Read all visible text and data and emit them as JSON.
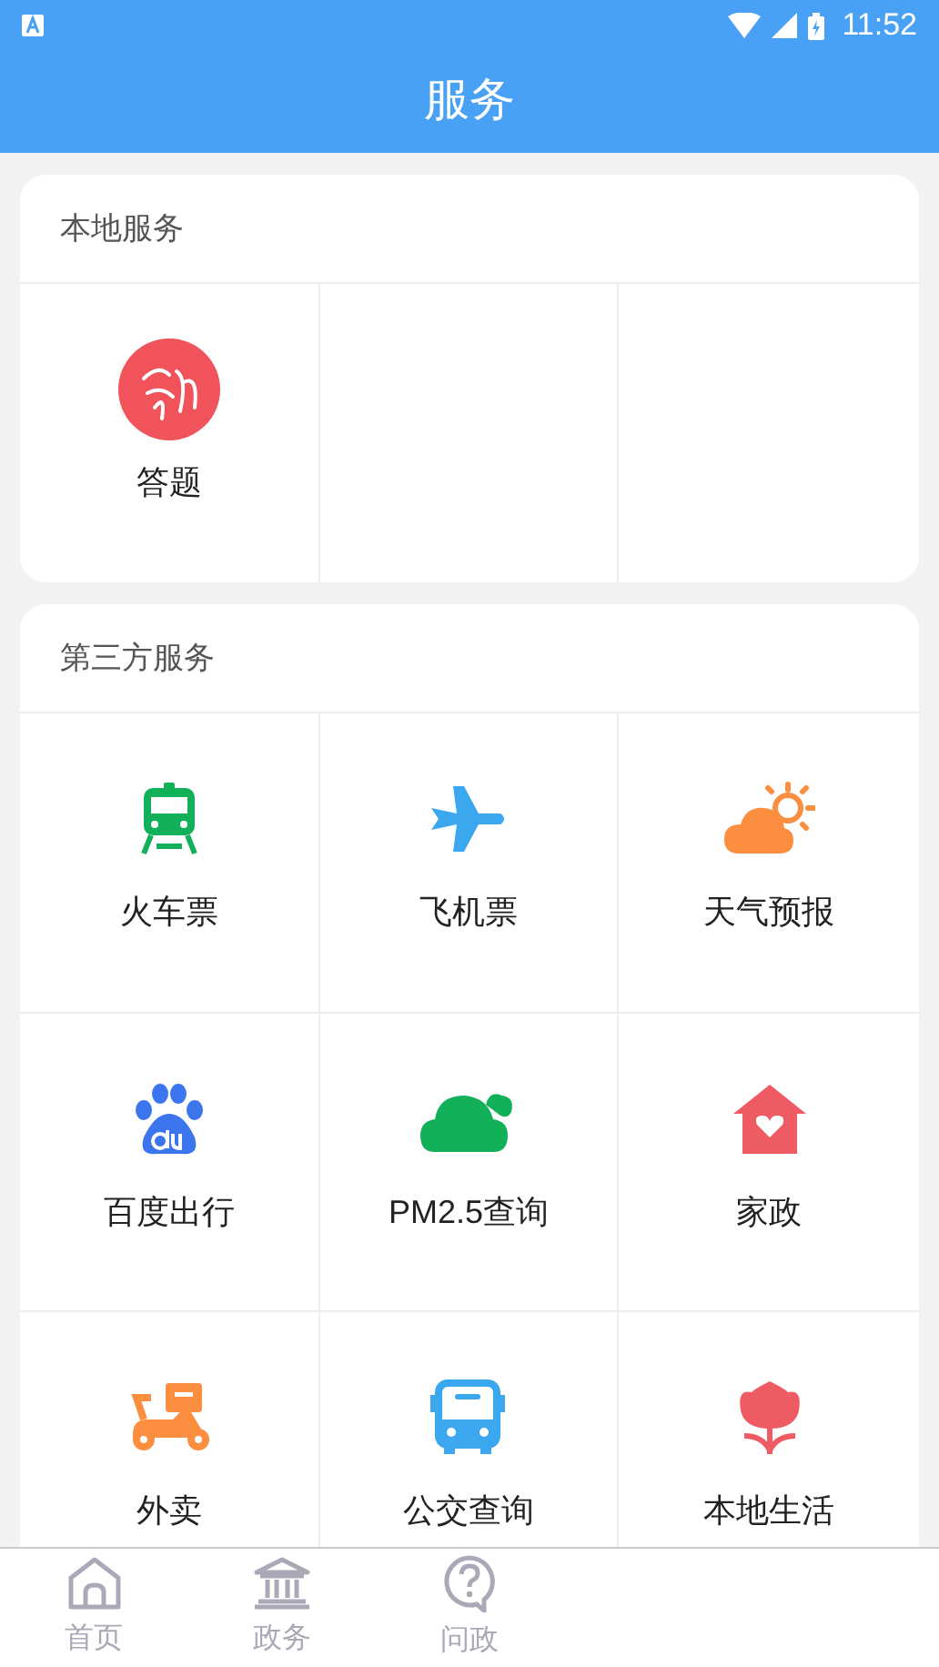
{
  "status_bar": {
    "time": "11:52"
  },
  "header": {
    "title": "服务"
  },
  "sections": [
    {
      "title": "本地服务",
      "items": [
        {
          "label": "答题",
          "kind": "study"
        }
      ]
    },
    {
      "title": "第三方服务",
      "items": [
        {
          "label": "火车票",
          "kind": "train"
        },
        {
          "label": "飞机票",
          "kind": "plane"
        },
        {
          "label": "天气预报",
          "kind": "weather"
        },
        {
          "label": "百度出行",
          "kind": "paw"
        },
        {
          "label": "PM2.5查询",
          "kind": "pm"
        },
        {
          "label": "家政",
          "kind": "house"
        },
        {
          "label": "外卖",
          "kind": "scooter"
        },
        {
          "label": "公交查询",
          "kind": "bus"
        },
        {
          "label": "本地生活",
          "kind": "flower"
        }
      ]
    }
  ],
  "bottom_nav": [
    {
      "label": "首页",
      "kind": "home",
      "selected": false
    },
    {
      "label": "政务",
      "kind": "bank",
      "selected": false
    },
    {
      "label": "问政",
      "kind": "question",
      "selected": false
    }
  ]
}
